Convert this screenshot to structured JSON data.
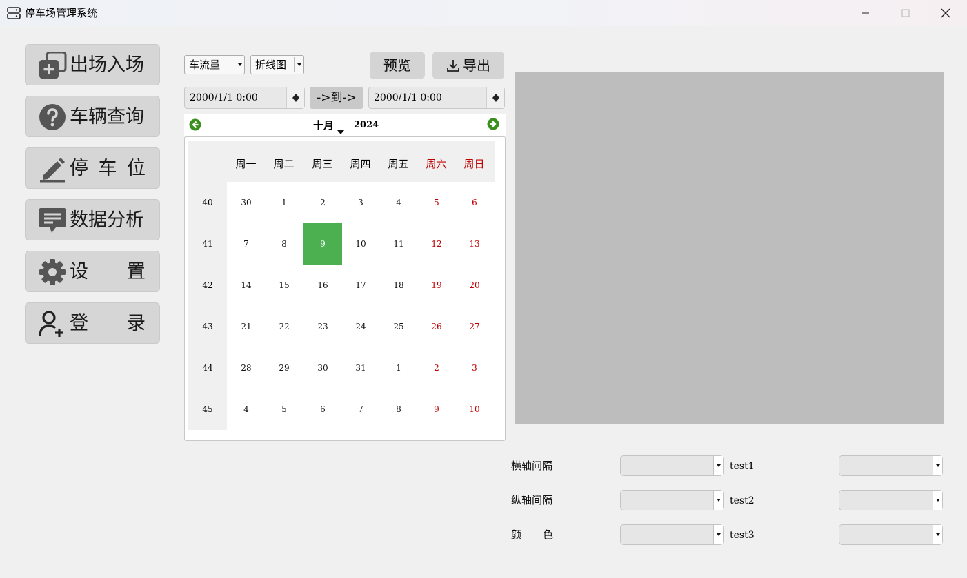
{
  "window": {
    "title": "停车场管理系统",
    "controls": [
      "minimize-icon",
      "maximize-icon",
      "close-icon"
    ]
  },
  "sidebar": {
    "items": [
      {
        "label": "出场入场",
        "icon": "add-copy-icon"
      },
      {
        "label": "车辆查询",
        "icon": "question-icon"
      },
      {
        "label": [
          "停",
          "车",
          "位"
        ],
        "icon": "pencil-icon"
      },
      {
        "label": "数据分析",
        "icon": "chat-bubble-icon"
      },
      {
        "label": [
          "设",
          "置"
        ],
        "icon": "gear-icon"
      },
      {
        "label": [
          "登",
          "录"
        ],
        "icon": "add-user-icon"
      }
    ]
  },
  "toolbar": {
    "metric_select": "车流量",
    "chart_type_select": "折线图",
    "preview_label": "预览",
    "export_label": "导出"
  },
  "range": {
    "start": "2000/1/1 0:00",
    "to_label": "->到->",
    "end": "2000/1/1 0:00"
  },
  "calendar": {
    "month": "十月",
    "year": "2024",
    "weekdays": [
      "周一",
      "周二",
      "周三",
      "周四",
      "周五",
      "周六",
      "周日"
    ],
    "weeks": [
      {
        "no": "40",
        "days": [
          "30",
          "1",
          "2",
          "3",
          "4",
          "5",
          "6"
        ]
      },
      {
        "no": "41",
        "days": [
          "7",
          "8",
          "9",
          "10",
          "11",
          "12",
          "13"
        ]
      },
      {
        "no": "42",
        "days": [
          "14",
          "15",
          "16",
          "17",
          "18",
          "19",
          "20"
        ]
      },
      {
        "no": "43",
        "days": [
          "21",
          "22",
          "23",
          "24",
          "25",
          "26",
          "27"
        ]
      },
      {
        "no": "44",
        "days": [
          "28",
          "29",
          "30",
          "31",
          "1",
          "2",
          "3"
        ]
      },
      {
        "no": "45",
        "days": [
          "4",
          "5",
          "6",
          "7",
          "8",
          "9",
          "10"
        ]
      }
    ],
    "selected_day": "9",
    "colors": {
      "weekend": "#c00000",
      "selected": "#4caf50",
      "nav_arrow": "#3a8f1e"
    }
  },
  "chart_settings": {
    "rows": [
      {
        "label": "横轴间隔",
        "test_label": "test1"
      },
      {
        "label": "纵轴间隔",
        "test_label": "test2"
      },
      {
        "label": [
          "颜",
          "色"
        ],
        "test_label": "test3"
      }
    ]
  }
}
